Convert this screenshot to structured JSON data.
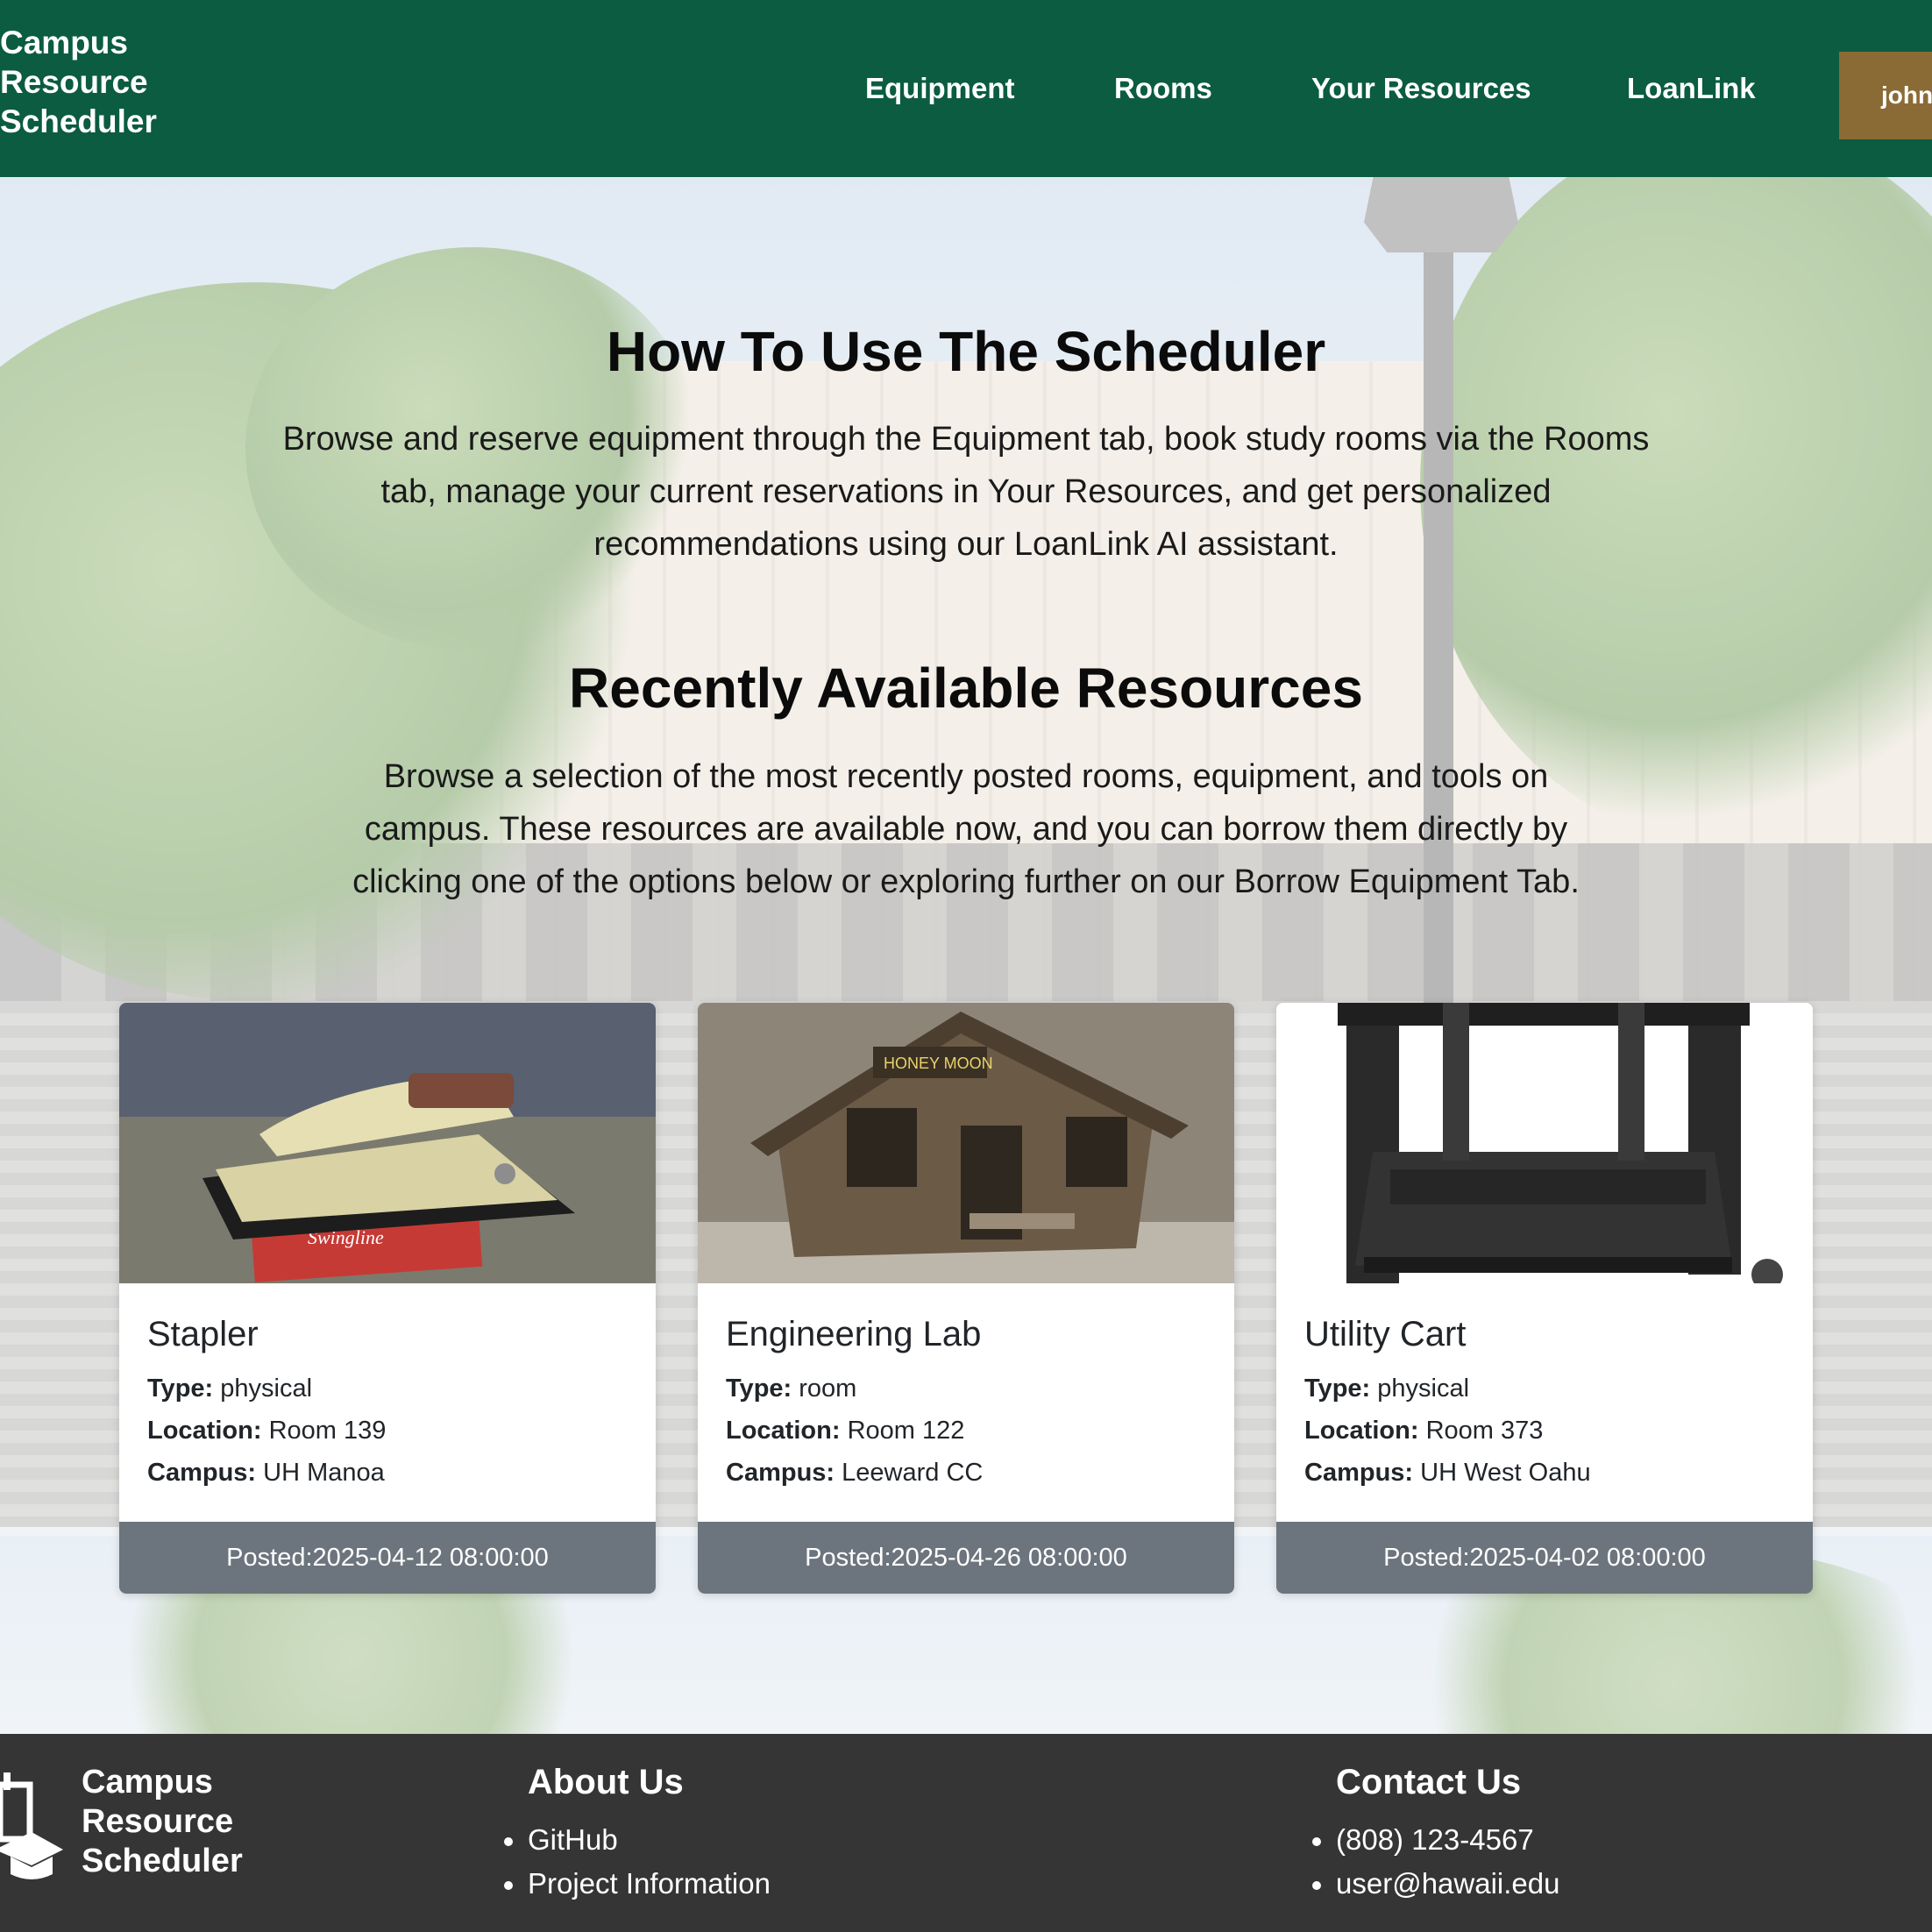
{
  "navbar": {
    "brand": [
      "Campus",
      "Resource",
      "Scheduler"
    ],
    "links": [
      "Equipment",
      "Rooms",
      "Your Resources",
      "LoanLink"
    ],
    "user_label": "john"
  },
  "how_to": {
    "title": "How To Use The Scheduler",
    "text": "Browse and reserve equipment through the Equipment tab, book study rooms via the Rooms tab, manage your current reservations in Your Resources, and get personalized recommendations using our LoanLink AI assistant."
  },
  "recent": {
    "title": "Recently Available Resources",
    "text": "Browse a selection of the most recently posted rooms, equipment, and tools on campus. These resources are available now, and you can borrow them directly by clicking one of the options below or exploring further on our Borrow Equipment Tab."
  },
  "labels": {
    "type": "Type:",
    "location": "Location:",
    "campus": "Campus:",
    "posted": "Posted:"
  },
  "cards": [
    {
      "title": "Stapler",
      "type": "physical",
      "location": "Room 139",
      "campus": "UH Manoa",
      "posted": "Posted:2025-04-12 08:00:00",
      "image": "stapler-photo"
    },
    {
      "title": "Engineering Lab",
      "type": "room",
      "location": "Room 122",
      "campus": "Leeward CC",
      "posted": "Posted:2025-04-26 08:00:00",
      "image": "cabin-photo"
    },
    {
      "title": "Utility Cart",
      "type": "physical",
      "location": "Room 373",
      "campus": "UH West Oahu",
      "posted": "Posted:2025-04-02 08:00:00",
      "image": "cart-photo"
    }
  ],
  "footer": {
    "brand": [
      "Campus",
      "Resource",
      "Scheduler"
    ],
    "about": {
      "heading": "About Us",
      "items": [
        "GitHub",
        "Project Information"
      ]
    },
    "contact": {
      "heading": "Contact Us",
      "items": [
        "(808) 123-4567",
        "user@hawaii.edu"
      ]
    }
  },
  "colors": {
    "navbar": "#0b5c40",
    "user_button": "#8b6b35",
    "card_footer": "#6c757d",
    "footer": "#353535"
  }
}
